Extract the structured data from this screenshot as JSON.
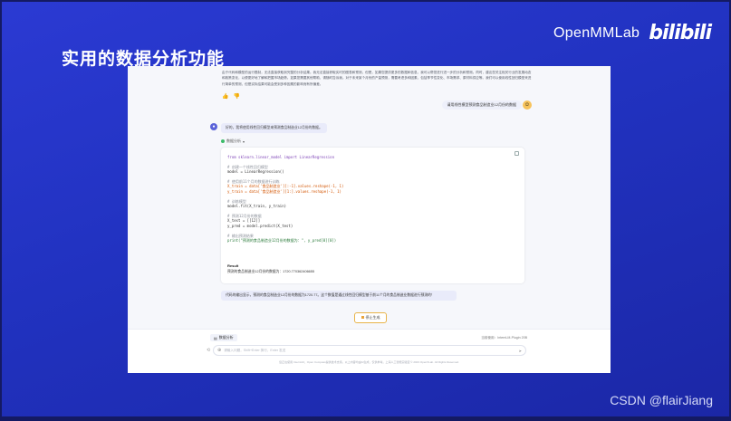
{
  "slide": {
    "title": "实用的数据分析功能",
    "brand_name": "OpenMMLab",
    "brand_logo": "bilibili",
    "watermark": "CSDN @flairJiang"
  },
  "chat": {
    "prev_answer_text": "由于代码和模型的运行限制，无法直接获取到完整的分析结果。我无法直接获取实时的图表和预测，但是，如果您提供更多的数据和信息，我可以帮您进行进一步的分析和预测。同时，建议您关注相关行业的发展动态和政策变化，以便更好地了解和把握市场趋势。如果您需要其他帮助，请随时告诉我。对于未来某个月份的产量预测，需要考虑多种因素，包括季节性变化、市场需求、原材料供应等。我们可以使用线性回归模型来进行简单的预测，但是实际结果可能会受到多种因素的影响而有所偏差。",
    "user_question": "请用线性模型预测食品制造业12月份的数据",
    "bot_intro": "好的，我将使用线性回归模型来预测食品制造业12月份的数据。",
    "tool_name": "数据分析",
    "code_lines": [
      {
        "text": "from sklearn.linear_model import LinearRegression",
        "cls": "kw"
      },
      {
        "text": "",
        "cls": ""
      },
      {
        "text": "# 创建一个线性回归模型",
        "cls": "comment"
      },
      {
        "text": "model = LinearRegression()",
        "cls": ""
      },
      {
        "text": "",
        "cls": ""
      },
      {
        "text": "# 使用前11个月的数据进行训练",
        "cls": "comment"
      },
      {
        "text": "X_train = data['食品制造业'][:-1].values.reshape(-1, 1)",
        "cls": "str"
      },
      {
        "text": "y_train = data['食品制造业'][1:].values.reshape(-1, 1)",
        "cls": "str"
      },
      {
        "text": "",
        "cls": ""
      },
      {
        "text": "# 训练模型",
        "cls": "comment"
      },
      {
        "text": "model.fit(X_train, y_train)",
        "cls": ""
      },
      {
        "text": "",
        "cls": ""
      },
      {
        "text": "# 预测12月份的数据",
        "cls": "comment"
      },
      {
        "text": "X_test = [[12]]",
        "cls": ""
      },
      {
        "text": "y_pred = model.predict(X_test)",
        "cls": ""
      },
      {
        "text": "",
        "cls": ""
      },
      {
        "text": "# 输出预测结果",
        "cls": "comment"
      },
      {
        "text": "print(\"预测的食品制造业12月份的数据为：\", y_pred[0][0])",
        "cls": "fn"
      }
    ],
    "result_title": "Result",
    "result_text": "预测的食品制造业12月份的数据为：1720.770362406655",
    "answer_text": "代码的输出显示，预测的食品制造业12月份的数据为1720.77。这个数值是通过线性回归模型基于前11个月的食品制造业数据进行预测的！",
    "stop_label": "停止生成"
  },
  "input": {
    "tag_label": "数据分析",
    "plugin_label": "当前使用：InternLM-Plugin 20B",
    "placeholder": "请输入问题，Shift+Enter 换行，Enter 发送",
    "footer": "您正在使用 InternLM，Open Compass提供技术支持。以上内容均由AI生成，仅供参考。上海人工智能实验室 © 2023 OpenXLab. All Rights Reserved."
  }
}
